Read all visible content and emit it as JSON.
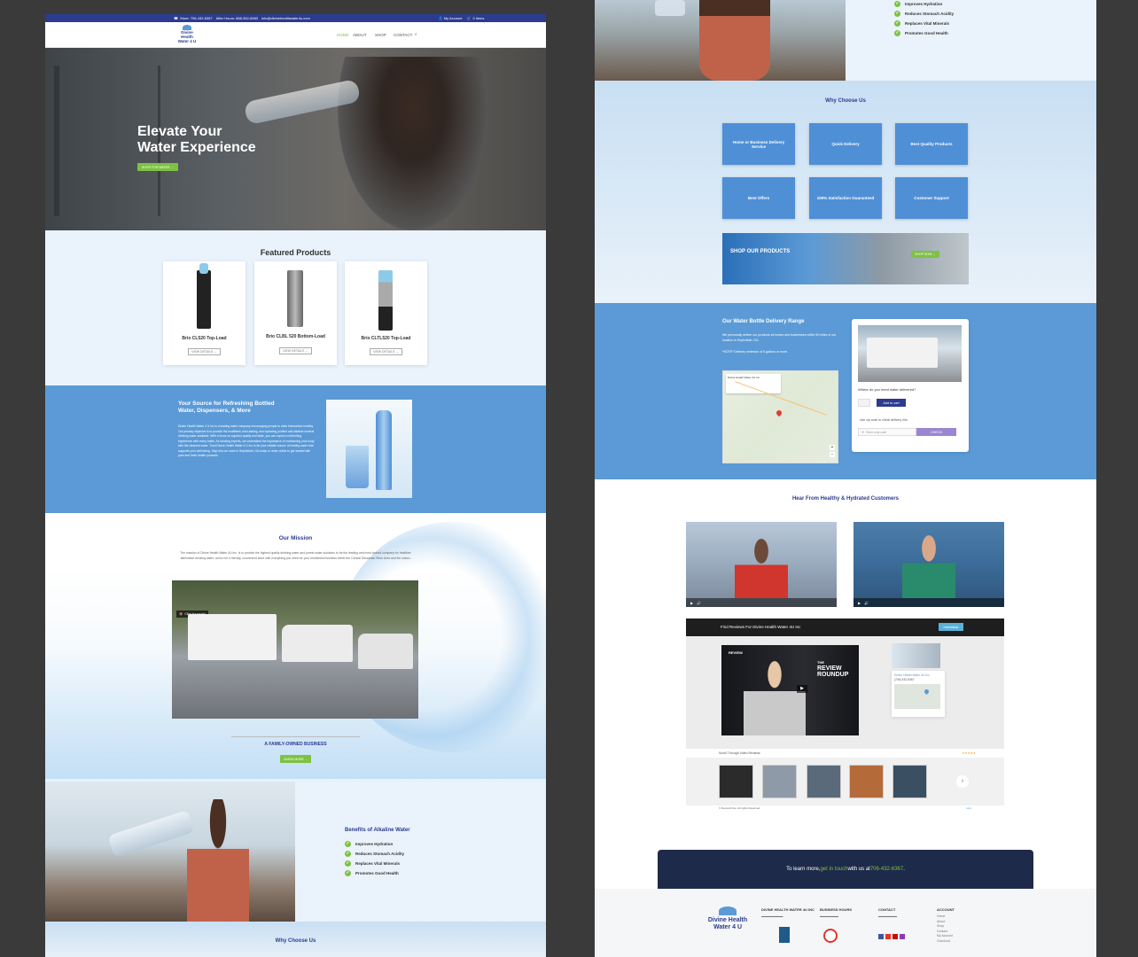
{
  "topbar": {
    "store_phone": "Store: 706-432-6367",
    "after_hours": "After Hours: 888-352-6583",
    "email": "info@divinehealthwater4u.com",
    "account": "My Account",
    "cart": "0 items"
  },
  "nav": {
    "logo_line1": "Divine Health",
    "logo_line2": "Water 4 U",
    "items": [
      "HOME",
      "ABOUT",
      "SHOP",
      "CONTACT"
    ]
  },
  "hero": {
    "title_line1": "Elevate Your",
    "title_line2": "Water Experience",
    "cta": "SHOP FOR WATER →"
  },
  "featured": {
    "title": "Featured Products",
    "products": [
      {
        "name": "Brio CL520 Top-Load",
        "button": "VIEW DETAILS →"
      },
      {
        "name": "Brio CLBL 520 Bottom-Load",
        "button": "VIEW DETAILS →"
      },
      {
        "name": "Brio CLTL520 Top-Load",
        "button": "VIEW DETAILS →"
      }
    ]
  },
  "source": {
    "title_line1": "Your Source for Refreshing Bottled",
    "title_line2": "Water, Dispensers, & More",
    "body": "Divine Health Water 4 U Inc is a leading water company encouraging people to drink themselves healthy. Our primary objective is to provide the healthiest, best-tasting, and hydrating purified and alkaline mineral drinking water available. With a focus on superior quality and taste, you can expect a refreshing experience with every bottle. As drinking experts, we understand the importance of maintaining your body with the cleanest water. Trust Divine Health Water 4 U Inc to be your reliable source of healthy water that supports your well-being. Stop into our store in Hephzibah, GA today or order online to get started with pure and fresh health products."
  },
  "mission": {
    "title": "Our Mission",
    "body": "The mission of Divine Health Water 4U Inc. is to provide the highest quality drinking water and purest water solutions to be the leading and most trusted company for healthier alternative drinking water, and to be a friendly, convenient store with everything you need for your residential business within the Central Savannah River Area and the nation.",
    "video_label": "Click for sound",
    "caption": "A FAMILY-OWNED BUSINESS",
    "cta": "LEARN MORE →"
  },
  "benefits": {
    "title": "Benefits of Alkaline Water",
    "items": [
      "Improves Hydration",
      "Reduces Stomach Acidity",
      "Replaces Vital Minerals",
      "Promotes Good Health"
    ]
  },
  "why": {
    "title": "Why Choose Us",
    "tiles": [
      "Home or Business Delivery Service",
      "Quick Delivery",
      "Best Quality Products",
      "Best Offers",
      "100% Satisfaction Guaranteed",
      "Customer Support"
    ]
  },
  "shop_banner": {
    "label": "SHOP OUR PRODUCTS",
    "cta": "SHOP NOW →"
  },
  "delivery": {
    "title": "Our Water Bottle Delivery Range",
    "body1": "We personally deliver our products at homes and businesses within 50 miles of our location in Hephzibah, GA.",
    "body2": "*NOTE* Delivery minimum of 5 gallons or more.",
    "map_place": "Divine Health Water 4U Inc",
    "question": "Where do you need water delivered?",
    "add_to_cart": "Add to cart",
    "zip_label": "Use zip code to check delivery info",
    "zip_placeholder": "Enter a zip code",
    "check": "CHECK"
  },
  "testimonials": {
    "title": "Hear From Healthy & Hydrated Customers",
    "reviews_bar": "Find Reviews For Divine Health Water 4U Inc",
    "reviews_badge": "reviewsbar",
    "review_title_1": "THE",
    "review_title_2": "REVIEW",
    "review_title_3": "ROUNDUP",
    "review_brand": "REVIEW",
    "biz_name": "Divine Health Water 4U Inc",
    "biz_phone": "(706) 432-6367",
    "scroll_text": "Scroll Through Video Reviews",
    "rights": "© ReviewTube. All rights Reserved."
  },
  "contact_strip": {
    "prefix": "To learn more, ",
    "link": "get in touch",
    "mid": " with us at ",
    "phone": "706-432-6367",
    "suffix": "."
  },
  "footer": {
    "col1_title": "DIVINE HEALTH WATER 4U INC",
    "col2_title": "BUSINESS HOURS",
    "col3_title": "CONTACT",
    "col4_title": "ACCOUNT",
    "col4_items": [
      "Home",
      "About",
      "Shop",
      "Contact",
      "My Account",
      "Checkout"
    ]
  },
  "colors": {
    "navy": "#2b3b8f",
    "blue": "#5b9ad6",
    "green": "#7dc242",
    "dark": "#1e2a4a"
  }
}
